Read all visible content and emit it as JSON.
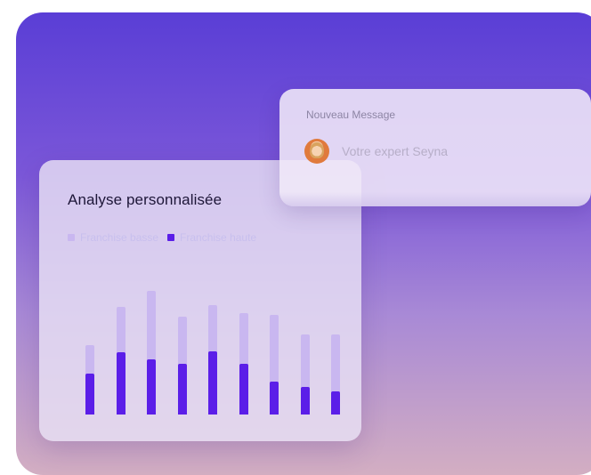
{
  "colors": {
    "bg_top": "#5a3ed6",
    "bg_bottom": "#d3aec2",
    "bar_light": "#c9b7f0",
    "bar_dark": "#5b1ee8",
    "title": "#1d1638"
  },
  "message_card": {
    "header": "Nouveau Message",
    "sender": "Votre expert Seyna",
    "avatar_icon": "user-avatar"
  },
  "chart_card": {
    "title": "Analyse personnalisée"
  },
  "chart_data": {
    "type": "bar",
    "title": "Analyse personnalisée",
    "categories": [
      "",
      "",
      "",
      "",
      "",
      "",
      "",
      "",
      ""
    ],
    "series": [
      {
        "name": "Franchise basse",
        "values": [
          73,
          113,
          130,
          103,
          115,
          106,
          105,
          84,
          84
        ]
      },
      {
        "name": "Franchise haute",
        "values": [
          43,
          65,
          58,
          53,
          66,
          53,
          35,
          29,
          24
        ]
      }
    ],
    "ylim": [
      0,
      140
    ],
    "legend": "top-left",
    "grid": false
  }
}
